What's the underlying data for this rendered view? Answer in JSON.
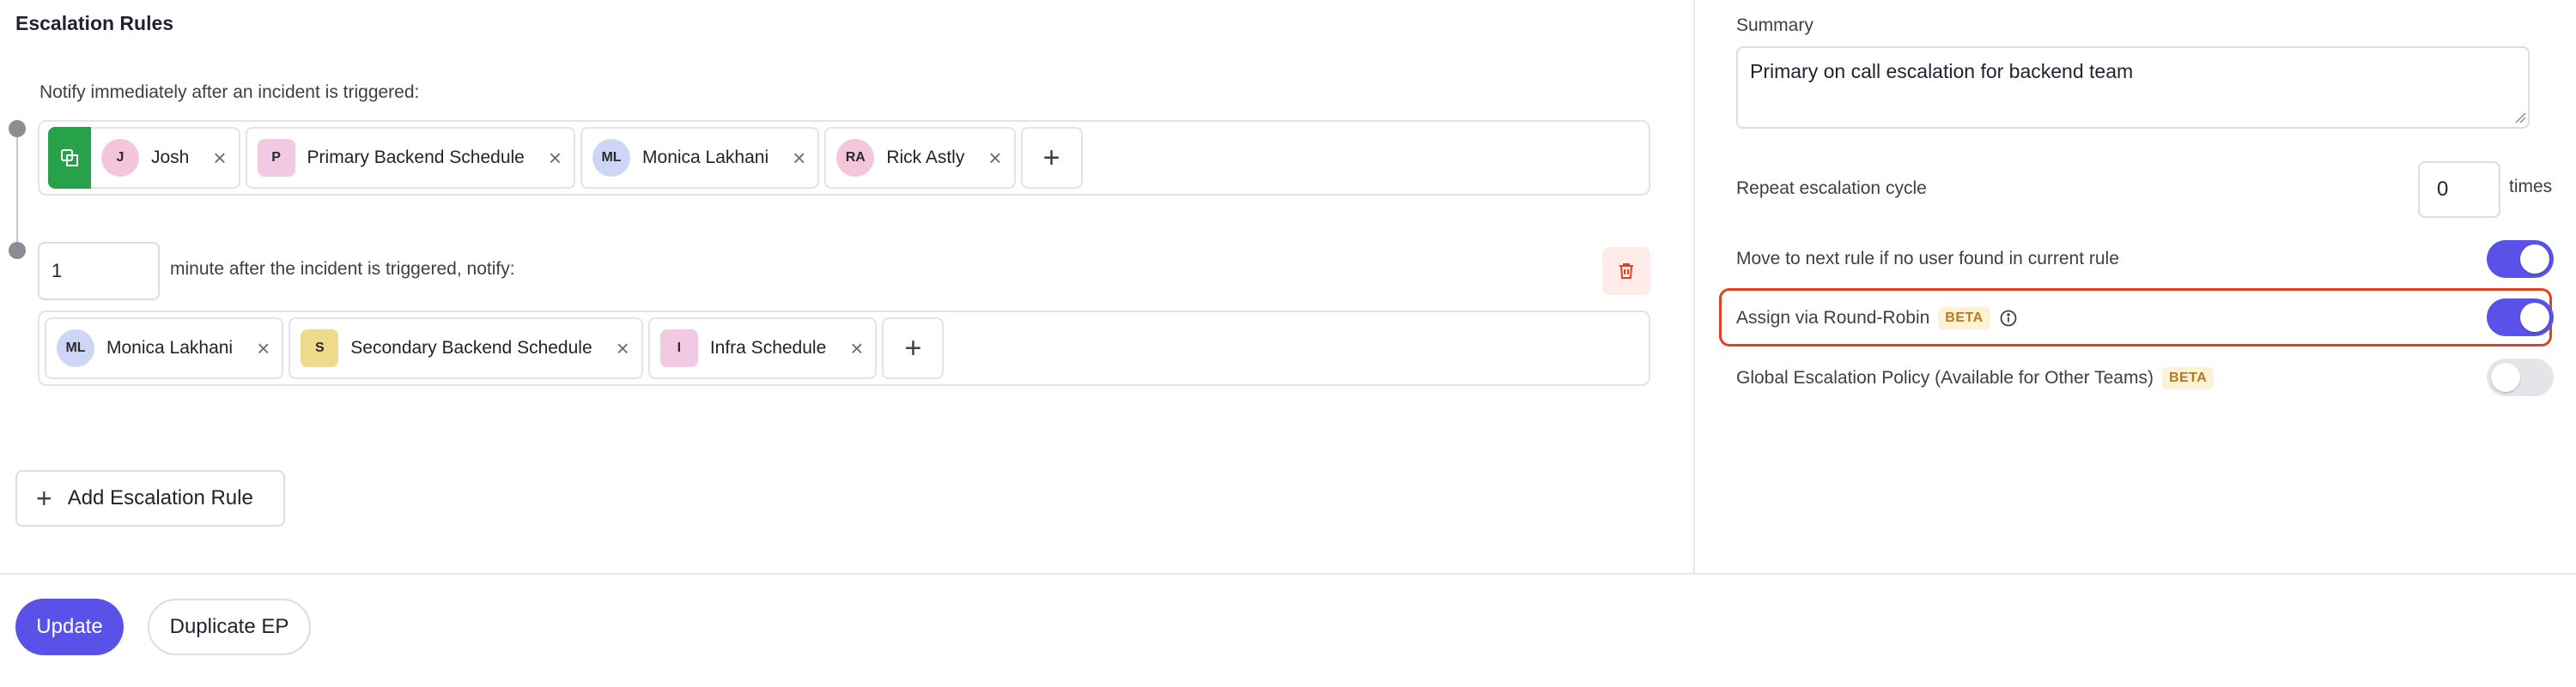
{
  "escalation": {
    "title": "Escalation Rules",
    "rule1": {
      "label": "Notify immediately after an incident is triggered:",
      "chips": [
        {
          "initials": "J",
          "name": "Josh",
          "color": "#f3c6dc",
          "shape": "circle"
        },
        {
          "initials": "P",
          "name": "Primary Backend Schedule",
          "color": "#f1c9e3",
          "shape": "square"
        },
        {
          "initials": "ML",
          "name": "Monica Lakhani",
          "color": "#cdd6f4",
          "shape": "circle"
        },
        {
          "initials": "RA",
          "name": "Rick Astly",
          "color": "#f3c6dc",
          "shape": "circle"
        }
      ],
      "add_label": "+"
    },
    "rule2": {
      "minutes": "1",
      "label": "minute after the incident is triggered, notify:",
      "chips": [
        {
          "initials": "ML",
          "name": "Monica Lakhani",
          "color": "#cdd6f4",
          "shape": "circle"
        },
        {
          "initials": "S",
          "name": "Secondary Backend Schedule",
          "color": "#efd98a",
          "shape": "square"
        },
        {
          "initials": "I",
          "name": "Infra Schedule",
          "color": "#f1c9e3",
          "shape": "square"
        }
      ],
      "add_label": "+"
    },
    "add_rule_label": "Add Escalation Rule"
  },
  "settings": {
    "summary_label": "Summary",
    "summary_value": "Primary on call escalation for backend team",
    "repeat_label": "Repeat escalation cycle",
    "repeat_value": "0",
    "repeat_unit": "times",
    "move_next_label": "Move to next rule if no user found in current rule",
    "move_next_on": true,
    "round_robin_label": "Assign via Round-Robin",
    "round_robin_badge": "BETA",
    "round_robin_on": true,
    "global_label": "Global Escalation Policy (Available for Other Teams)",
    "global_badge": "BETA",
    "global_on": false
  },
  "footer": {
    "update_label": "Update",
    "duplicate_label": "Duplicate EP"
  },
  "colors": {
    "accent": "#5a52e8",
    "highlight": "#e0411f",
    "lead_icon": "#27a14a",
    "delete_bg": "#fdecea"
  }
}
